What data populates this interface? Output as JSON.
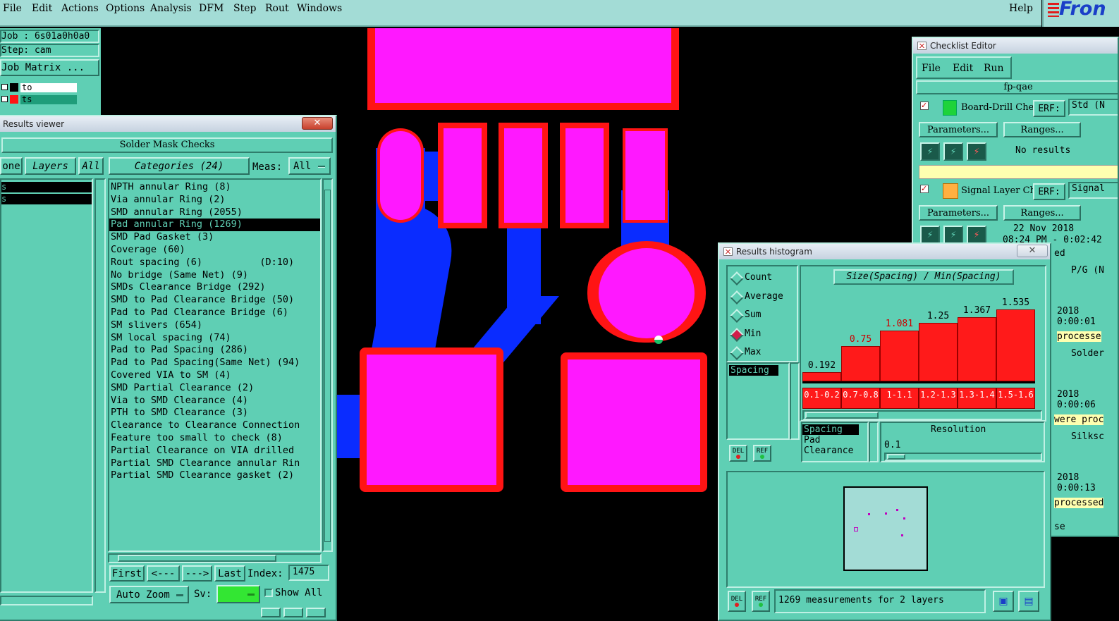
{
  "menubar": {
    "items": [
      "File",
      "Edit",
      "Actions",
      "Options",
      "Analysis",
      "DFM",
      "Step",
      "Rout",
      "Windows"
    ],
    "help": "Help",
    "logo": "Fron"
  },
  "job_panel": {
    "job": "Job : 6s01a0h0a0",
    "step": "Step: cam",
    "matrix_button": "Job Matrix ...",
    "layer1": "to",
    "layer2": "ts"
  },
  "results_viewer": {
    "title": "Results viewer",
    "header": "Solder Mask Checks",
    "none_btn": "one",
    "layers_btn": "Layers",
    "all_btn": "All",
    "categories_btn": "Categories (24)",
    "meas_label": "Meas:",
    "meas_value": "All",
    "left_items": [
      "s",
      "s"
    ],
    "categories": [
      "NPTH annular Ring (8)",
      "Via annular Ring (2)",
      "SMD annular Ring (2055)",
      "Pad annular Ring (1269)",
      "SMD Pad Gasket (3)",
      "Coverage (60)",
      "Rout spacing (6)          (D:10)",
      "No bridge (Same Net) (9)",
      "SMDs Clearance Bridge (292)",
      "SMD to Pad Clearance Bridge (50)",
      "Pad to Pad Clearance Bridge (6)",
      "SM slivers (654)",
      "SM local spacing (74)",
      "Pad to Pad Spacing (286)",
      "Pad to Pad Spacing(Same Net) (94)",
      "Covered VIA to SM (4)",
      "SMD Partial Clearance (2)",
      "Via to SMD Clearance (4)",
      "PTH to SMD Clearance (3)",
      "Clearance to Clearance Connection",
      "Feature too small to check (8)",
      "Partial Clearance on VIA drilled",
      "Partial SMD Clearance annular Rin",
      "Partial SMD Clearance gasket (2)"
    ],
    "selected_index": 3,
    "first_btn": "First",
    "prev_btn": "<---",
    "next_btn": "--->",
    "last_btn": "Last",
    "index_label": "Index:",
    "index_value": "1475",
    "auto_zoom": "Auto Zoom",
    "sv_label": "Sv:",
    "show_all": "Show All"
  },
  "checklist": {
    "title": "Checklist Editor",
    "menu": [
      "File",
      "Edit",
      "Run"
    ],
    "name": "fp-qae",
    "check1": {
      "label": "Board-Drill Che",
      "erf": "ERF:",
      "erf_val": "Std (N",
      "params": "Parameters...",
      "ranges": "Ranges...",
      "status": "No results"
    },
    "check2": {
      "label": "Signal Layer Ch",
      "erf": "ERF:",
      "erf_val": "Signal",
      "params": "Parameters...",
      "ranges": "Ranges...",
      "date": "22 Nov 2018",
      "time": "08:24 PM - 0:02:42"
    },
    "side_texts": [
      "ed",
      "P/G (N",
      "2018",
      "0:00:01",
      "processe",
      "Solder",
      "2018",
      "0:00:06",
      "were proc",
      "Silksc",
      "2018",
      "0:00:13",
      "processed",
      "se"
    ]
  },
  "histogram": {
    "title": "Results histogram",
    "modes": [
      "Count",
      "Average",
      "Sum",
      "Min",
      "Max"
    ],
    "active_mode": "Min",
    "chart_title": "Size(Spacing) / Min(Spacing)",
    "list_items": [
      "Spacing"
    ],
    "attr_items": [
      "Spacing",
      "Pad",
      "Clearance"
    ],
    "resolution_label": "Resolution",
    "resolution_value": "0.1",
    "status": "1269 measurements for 2 layers",
    "del_label": "DEL",
    "ref_label": "REF"
  },
  "chart_data": {
    "type": "bar",
    "title": "Size(Spacing) / Min(Spacing)",
    "categories": [
      "0.1-0.2",
      "0.7-0.8",
      "1-1.1",
      "1.2-1.3",
      "1.3-1.4",
      "1.5-1.6"
    ],
    "values": [
      0.192,
      0.75,
      1.081,
      1.25,
      1.367,
      1.535
    ],
    "value_labels": [
      "0.192",
      "0.75",
      "1.081",
      "1.25",
      "1.367",
      "1.535"
    ],
    "highlight_colors": [
      "#000000",
      "#cc0000",
      "#cc0000",
      "#000000",
      "#000000",
      "#000000"
    ],
    "ylim": [
      0,
      1.6
    ]
  },
  "colors": {
    "teal": "#5fcfb4",
    "pad_fill": "#ff18ff",
    "pad_outline": "#ff1414",
    "trace": "#0a2cff",
    "menu": "#a3dcd6"
  }
}
